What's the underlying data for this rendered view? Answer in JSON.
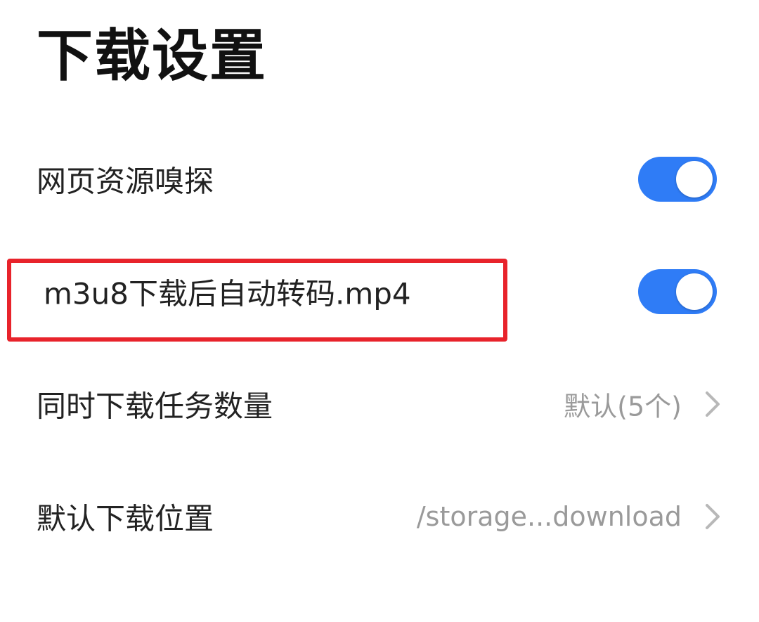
{
  "page": {
    "title": "下载设置"
  },
  "settings": [
    {
      "label": "网页资源嗅探",
      "type": "toggle",
      "enabled": true
    },
    {
      "label": "m3u8下载后自动转码.mp4",
      "type": "toggle",
      "enabled": true
    },
    {
      "label": "同时下载任务数量",
      "type": "select",
      "value": "默认(5个)"
    },
    {
      "label": "默认下载位置",
      "type": "select",
      "value": "/storage...download"
    }
  ],
  "colors": {
    "accent": "#2f7cf6",
    "highlight": "#e8232b",
    "value_text": "#9a9a9a"
  },
  "icons": {
    "chevron": "chevron-right-icon"
  }
}
